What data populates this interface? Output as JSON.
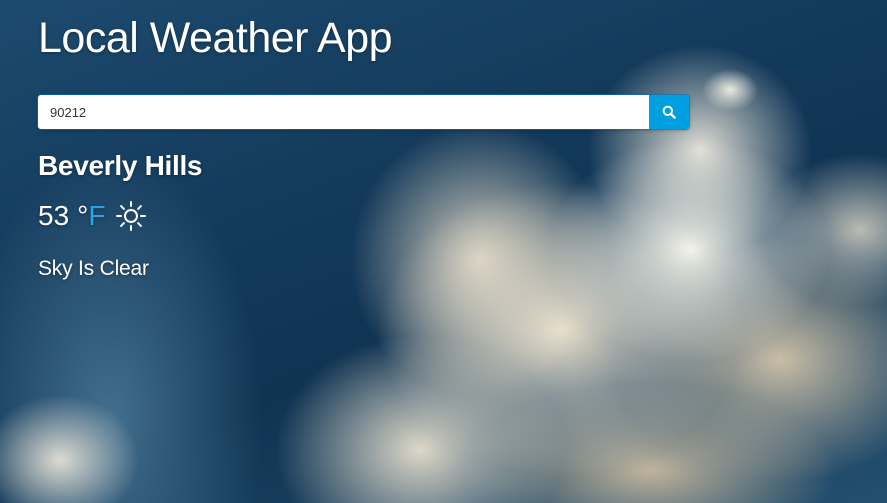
{
  "app": {
    "title": "Local Weather App"
  },
  "search": {
    "value": "90212",
    "button_icon": "search-icon"
  },
  "weather": {
    "city": "Beverly Hills",
    "temperature": "53",
    "degree_symbol": "°",
    "unit": "F",
    "condition_icon": "sun-icon",
    "description": "Sky Is Clear"
  },
  "colors": {
    "accent": "#00a0e0",
    "unit_link": "#2aa3e6",
    "text": "#ffffff"
  }
}
